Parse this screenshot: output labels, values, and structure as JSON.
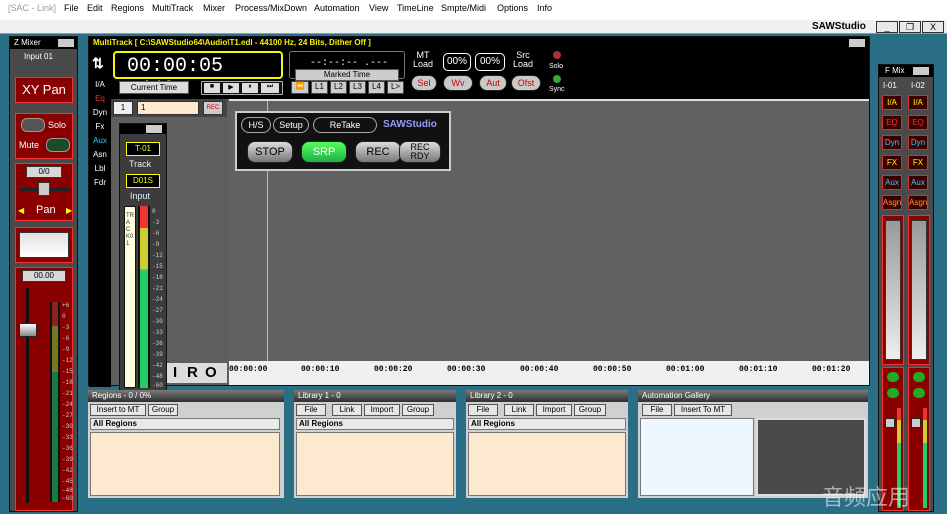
{
  "titlebar": {
    "app_tag": "[SAC - Link]"
  },
  "menu": [
    "File",
    "Edit",
    "Regions",
    "MultiTrack",
    "Mixer",
    "Process/MixDown",
    "Automation",
    "View",
    "TimeLine",
    "Smpte/Midi",
    "Options",
    "Info"
  ],
  "window": {
    "title": "SAWStudio",
    "minimize": "_",
    "restore": "❐",
    "close": "X"
  },
  "zmixer": {
    "title": "Z Mixer",
    "input": "Input 01",
    "xy_pan": "XY Pan",
    "solo": "Solo",
    "mute": "Mute",
    "pan_value": "0/0",
    "pan": "Pan",
    "gain_value": "00.00",
    "scale": [
      "+6",
      "0",
      "-3",
      "-6",
      "-9",
      "-12",
      "-15",
      "-18",
      "-21",
      "-24",
      "-27",
      "-30",
      "-33",
      "-36",
      "-39",
      "-42",
      "-45",
      "-48",
      "-60"
    ]
  },
  "multitrack": {
    "header": "MultiTrack  [ C:\\SAWStudio64\\Audio\\T1.edl - 44100 Hz, 24 Bits, Dither Off ]",
    "counter": "00:00:05 .449",
    "current_time": "Current Time",
    "marked_value": "--:--:-- .---",
    "marked_time": "Marked Time",
    "mt_load": "MT\nLoad",
    "pct1": "00%",
    "pct2": "00%",
    "src_load": "Src\nLoad",
    "solo": "Solo",
    "sync": "Sync",
    "sel": "Sel",
    "wv": "Wv",
    "aut": "Aut",
    "ofst": "Ofst",
    "locators": [
      "L1",
      "L2",
      "L3",
      "L4",
      "L>"
    ],
    "sidetabs": [
      "I/A",
      "Eq",
      "Dyn",
      "Fx",
      "Aux",
      "Asn",
      "Lbl",
      "Fdr"
    ],
    "track_field": "1",
    "track_name": "1",
    "rec": "REC",
    "track_id": "T-01",
    "track_label": "Track",
    "input_id": "D01S",
    "input_label": "Input",
    "track_vertical": "TRACK01",
    "meter_scale": [
      "0",
      "-3",
      "-6",
      "-9",
      "-12",
      "-15",
      "-18",
      "-21",
      "-24",
      "-27",
      "-30",
      "-33",
      "-36",
      "-39",
      "-42",
      "-48",
      "-60"
    ],
    "iro": [
      "I",
      "R",
      "O"
    ],
    "timeline": [
      "00:00:00",
      "00:00:10",
      "00:00:20",
      "00:00:30",
      "00:00:40",
      "00:00:50",
      "00:01:00",
      "00:01:10",
      "00:01:20"
    ]
  },
  "transport": {
    "hs": "H/S",
    "setup": "Setup",
    "retake": "ReTake",
    "brand": "SAWStudio",
    "stop": "STOP",
    "srp": "SRP",
    "rec": "REC",
    "rec_rdy": "REC\nRDY"
  },
  "regions": {
    "title": "Regions - 0 / 0%",
    "insert": "Insert to MT",
    "group": "Group",
    "list_header": "All Regions"
  },
  "library1": {
    "title": "Library 1 - 0",
    "file": "File",
    "link": "Link",
    "import": "Import",
    "group": "Group",
    "list_header": "All Regions"
  },
  "library2": {
    "title": "Library 2 - 0",
    "file": "File",
    "link": "Link",
    "import": "Import",
    "group": "Group",
    "list_header": "All Regions"
  },
  "automation": {
    "title": "Automation Gallery",
    "file": "File",
    "insert": "Insert To MT"
  },
  "fmix": {
    "title": "F Mix",
    "ch1": "I-01",
    "ch2": "I-02",
    "buttons": [
      "I/A",
      "EQ",
      "Dyn",
      "FX",
      "Aux",
      "Asgn"
    ]
  },
  "watermark": "音频应用",
  "colors": {
    "accent_blue": "#2b6f86",
    "lcd_green": "#e8e8e8",
    "srp_green": "#1fb04a",
    "header_yellow": "#f6f600"
  }
}
